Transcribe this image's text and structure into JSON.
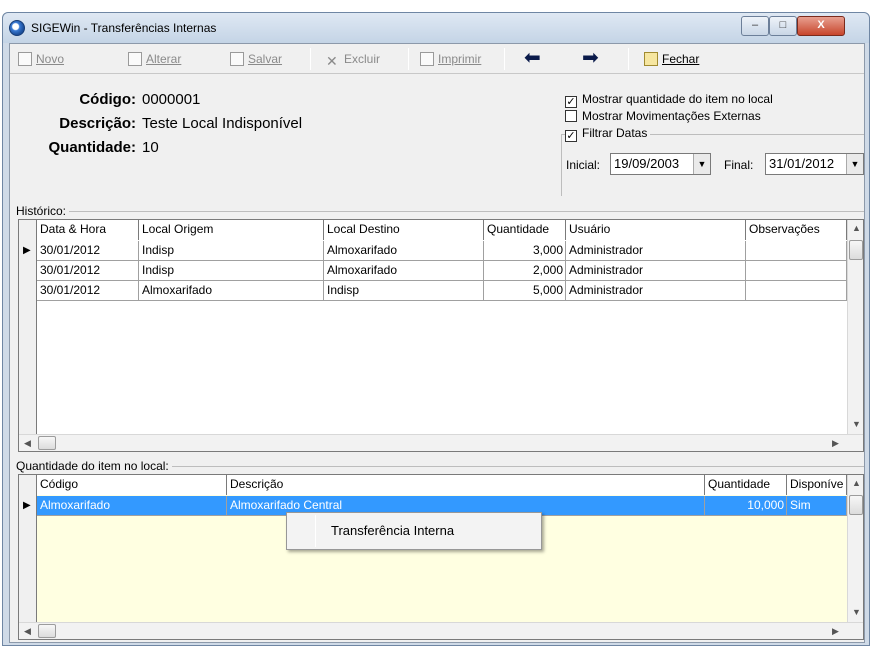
{
  "window": {
    "title": "SIGEWin - Transferências Internas",
    "min": "–",
    "max": "□",
    "close": "X"
  },
  "toolbar": {
    "novo": "Novo",
    "alterar": "Alterar",
    "salvar": "Salvar",
    "excluir": "Excluir",
    "imprimir": "Imprimir",
    "prev": "◆",
    "next": "➡",
    "fechar": "Fechar"
  },
  "info": {
    "codigo_label": "Código:",
    "codigo_value": "0000001",
    "descricao_label": "Descrição:",
    "descricao_value": "Teste Local Indisponível",
    "quantidade_label": "Quantidade:",
    "quantidade_value": "10"
  },
  "options": {
    "mostrar_qtd": {
      "label": "Mostrar quantidade do item no local",
      "checked": "✓"
    },
    "mostrar_mov": {
      "label": "Mostrar Movimentações Externas",
      "checked": ""
    },
    "filtrar_datas": {
      "label": "Filtrar Datas",
      "checked": "✓"
    },
    "inicial_label": "Inicial:",
    "inicial_value": "19/09/2003",
    "final_label": "Final:",
    "final_value": "31/01/2012"
  },
  "historico": {
    "title": "Histórico:",
    "columns": [
      "Data & Hora",
      "Local Origem",
      "Local Destino",
      "Quantidade",
      "Usuário",
      "Observações"
    ],
    "rows": [
      [
        "30/01/2012",
        "Indisp",
        "Almoxarifado",
        "3,000",
        "Administrador",
        ""
      ],
      [
        "30/01/2012",
        "Indisp",
        "Almoxarifado",
        "2,000",
        "Administrador",
        ""
      ],
      [
        "30/01/2012",
        "Almoxarifado",
        "Indisp",
        "5,000",
        "Administrador",
        ""
      ]
    ]
  },
  "quantidade_local": {
    "title": "Quantidade do item no local:",
    "columns": [
      "Código",
      "Descrição",
      "Quantidade",
      "Disponíve"
    ],
    "rows": [
      [
        "Almoxarifado",
        "Almoxarifado Central",
        "10,000",
        "Sim"
      ]
    ]
  },
  "context_menu": {
    "item": "Transferência Interna"
  },
  "colors": {
    "selection": "#3399ff",
    "yellow_area": "#ffffe1"
  }
}
